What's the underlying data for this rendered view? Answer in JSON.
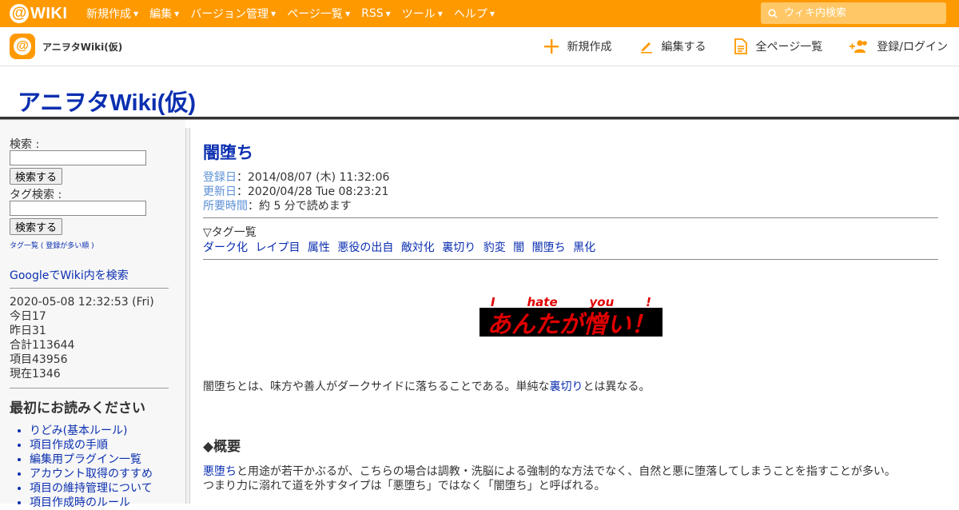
{
  "topbar": {
    "logo_text": "WIKI",
    "menu": [
      {
        "label": "新規作成"
      },
      {
        "label": "編集"
      },
      {
        "label": "バージョン管理"
      },
      {
        "label": "ページ一覧"
      },
      {
        "label": "RSS"
      },
      {
        "label": "ツール"
      },
      {
        "label": "ヘルプ"
      }
    ],
    "search_placeholder": "ウィキ内検索"
  },
  "subbar": {
    "site_name": "アニヲタWiki(仮)",
    "actions": {
      "new": "新規作成",
      "edit": "編集する",
      "all_pages": "全ページ一覧",
      "login": "登録/ログイン"
    }
  },
  "wiki_title": "アニヲタWiki(仮)",
  "menu": {
    "search_label": "検索 :",
    "search_button": "検索する",
    "tag_search_label": "タグ検索 :",
    "tag_search_button": "検索する",
    "tag_list_link": "タグ一覧 ( 登録が多い順 )",
    "google_search": "GoogleでWiki内を検索",
    "stats": {
      "datetime": "2020-05-08 12:32:53 (Fri)",
      "today": "今日17",
      "yesterday": "昨日31",
      "total": "合計113644",
      "items": "項目43956",
      "now": "現在1346"
    },
    "read_first_title": "最初にお読みください",
    "read_first_items": [
      "りどみ(基本ルール)",
      "項目作成の手順",
      "編集用プラグイン一覧",
      "アカウント取得のすすめ",
      "項目の維持管理について",
      "項目作成時のルール"
    ]
  },
  "page": {
    "title": "闇堕ち",
    "registered_label": "登録日",
    "registered_value": "：2014/08/07 (木) 11:32:06",
    "updated_label": "更新日",
    "updated_value": "：2020/04/28 Tue 08:23:21",
    "read_time_label": "所要時間",
    "read_time_value": "：約 5 分で読めます",
    "tag_header": "▽タグ一覧",
    "tags": [
      "ダーク化",
      "レイプ目",
      "属性",
      "悪役の出自",
      "敵対化",
      "裏切り",
      "豹変",
      "闇",
      "闇堕ち",
      "黒化"
    ],
    "banner_words": [
      "I",
      "hate",
      "you",
      "!"
    ],
    "banner_main": "あんたが憎い！",
    "intro_before": "闇堕ちとは、味方や善人がダークサイドに落ちることである。単純な",
    "intro_link": "裏切り",
    "intro_after": "とは異なる。",
    "section_title": "◆概要",
    "summary1_link": "悪堕ち",
    "summary1_text": "と用途が若干かぶるが、こちらの場合は調教・洗脳による強制的な方法でなく、自然と悪に堕落してしまうことを指すことが多い。",
    "summary2_text": "つまり力に溺れて道を外すタイプは「悪堕ち」ではなく「闇堕ち」と呼ばれる。"
  },
  "colors": {
    "brand": "#ff9900",
    "link": "#0b2fb0",
    "meta_label": "#5b8fd6",
    "banner_text": "#e00000"
  }
}
